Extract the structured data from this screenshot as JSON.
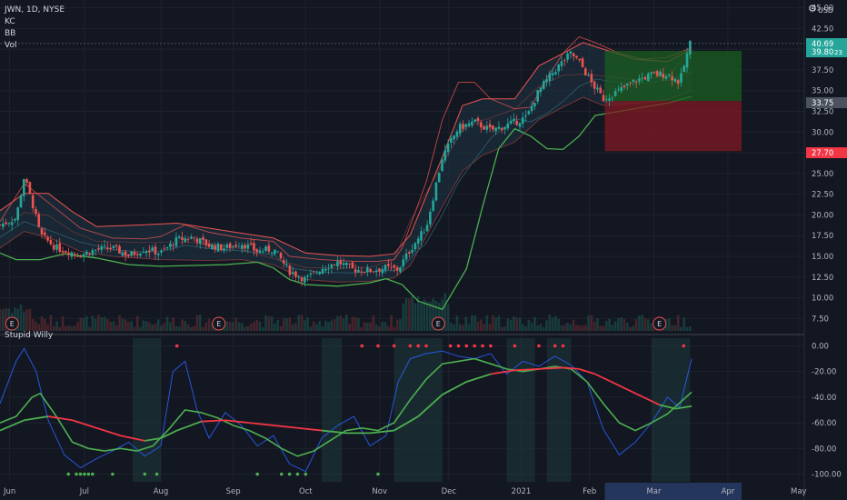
{
  "header": {
    "symbol": "JWN, 1D, NYSE",
    "indicators": [
      "KC",
      "BB",
      "Vol"
    ],
    "currency": "USD",
    "lower_pane_title": "Stupid Willy"
  },
  "colors": {
    "background": "#131722",
    "grid": "#1e222d",
    "up": "#26a69a",
    "down": "#ef5350",
    "kc": "#ef5350",
    "bb": "#4caf50",
    "kc_fill": "#1f3445",
    "profit": "#1b5e20",
    "loss": "#801922",
    "osc_blue": "#2962ff",
    "osc_green": "#4caf50",
    "osc_red": "#f23645"
  },
  "chart_data": {
    "type": "candlestick",
    "x_ticks": [
      "Jun",
      "Jul",
      "Aug",
      "Sep",
      "Oct",
      "Nov",
      "Dec",
      "2021",
      "Feb",
      "Mar",
      "Apr",
      "May"
    ],
    "y_ticks": [
      "45.00",
      "42.50",
      "40.00",
      "37.50",
      "35.00",
      "32.50",
      "30.00",
      "27.50",
      "25.00",
      "22.50",
      "20.00",
      "17.50",
      "15.00",
      "12.50",
      "10.00",
      "7.50"
    ],
    "ylim": [
      6.0,
      45.5
    ],
    "price_labels": [
      {
        "text": "40.69",
        "value": 40.69,
        "color": "#26a69a"
      },
      {
        "text": "39.80",
        "value": 39.8,
        "color": "#26a69a"
      },
      {
        "text": "33.75",
        "value": 33.75,
        "color": "#4c525e"
      },
      {
        "text": "27.70",
        "value": 27.7,
        "color": "#f23645"
      }
    ],
    "price_label_extra": "23",
    "earnings_markers": [
      {
        "label": "E",
        "x_pos": 0.015
      },
      {
        "label": "E",
        "x_pos": 0.272
      },
      {
        "label": "E",
        "x_pos": 0.545
      },
      {
        "label": "E",
        "x_pos": 0.82
      }
    ],
    "position_box": {
      "entry": 33.75,
      "target": 39.8,
      "stop": 27.7,
      "start": 0.752,
      "end": 0.922
    },
    "price_series": {
      "close": [
        [
          0.0,
          18.8
        ],
        [
          0.02,
          19.6
        ],
        [
          0.03,
          24.6
        ],
        [
          0.04,
          21.5
        ],
        [
          0.05,
          17.6
        ],
        [
          0.07,
          16.0
        ],
        [
          0.1,
          15.2
        ],
        [
          0.12,
          15.8
        ],
        [
          0.14,
          16.0
        ],
        [
          0.16,
          15.1
        ],
        [
          0.18,
          15.9
        ],
        [
          0.2,
          15.4
        ],
        [
          0.22,
          17.0
        ],
        [
          0.24,
          17.3
        ],
        [
          0.26,
          16.3
        ],
        [
          0.28,
          16.0
        ],
        [
          0.3,
          16.6
        ],
        [
          0.32,
          15.6
        ],
        [
          0.34,
          15.9
        ],
        [
          0.36,
          13.2
        ],
        [
          0.38,
          12.2
        ],
        [
          0.4,
          13.6
        ],
        [
          0.42,
          14.3
        ],
        [
          0.44,
          13.4
        ],
        [
          0.46,
          13.3
        ],
        [
          0.48,
          13.6
        ],
        [
          0.495,
          13.4
        ],
        [
          0.51,
          15.8
        ],
        [
          0.53,
          18.5
        ],
        [
          0.55,
          27.0
        ],
        [
          0.57,
          30.5
        ],
        [
          0.59,
          31.2
        ],
        [
          0.61,
          30.2
        ],
        [
          0.63,
          30.8
        ],
        [
          0.655,
          31.8
        ],
        [
          0.67,
          35.0
        ],
        [
          0.69,
          37.5
        ],
        [
          0.71,
          39.5
        ],
        [
          0.722,
          38.2
        ],
        [
          0.735,
          36.0
        ],
        [
          0.75,
          34.0
        ],
        [
          0.77,
          35.0
        ],
        [
          0.79,
          36.2
        ],
        [
          0.81,
          36.9
        ],
        [
          0.83,
          37.0
        ],
        [
          0.845,
          36.0
        ],
        [
          0.858,
          40.7
        ]
      ],
      "keltner_upper": [
        [
          0.0,
          20.5
        ],
        [
          0.03,
          22.6
        ],
        [
          0.06,
          22.6
        ],
        [
          0.09,
          20.4
        ],
        [
          0.12,
          18.6
        ],
        [
          0.18,
          18.8
        ],
        [
          0.22,
          19.0
        ],
        [
          0.26,
          18.4
        ],
        [
          0.3,
          17.8
        ],
        [
          0.34,
          17.2
        ],
        [
          0.38,
          15.4
        ],
        [
          0.42,
          15.1
        ],
        [
          0.46,
          15.0
        ],
        [
          0.49,
          15.3
        ],
        [
          0.51,
          17.6
        ],
        [
          0.55,
          27.0
        ],
        [
          0.575,
          33.2
        ],
        [
          0.6,
          34.0
        ],
        [
          0.64,
          34.0
        ],
        [
          0.67,
          38.0
        ],
        [
          0.7,
          39.5
        ],
        [
          0.725,
          40.8
        ],
        [
          0.75,
          40.0
        ],
        [
          0.79,
          38.8
        ],
        [
          0.83,
          38.5
        ],
        [
          0.86,
          40.0
        ]
      ],
      "keltner_lower": [
        [
          0.0,
          16.0
        ],
        [
          0.03,
          18.0
        ],
        [
          0.06,
          17.3
        ],
        [
          0.1,
          15.6
        ],
        [
          0.14,
          15.0
        ],
        [
          0.2,
          14.6
        ],
        [
          0.26,
          14.5
        ],
        [
          0.3,
          14.6
        ],
        [
          0.34,
          14.0
        ],
        [
          0.38,
          12.2
        ],
        [
          0.42,
          11.9
        ],
        [
          0.46,
          12.0
        ],
        [
          0.49,
          12.4
        ],
        [
          0.51,
          13.9
        ],
        [
          0.55,
          21.0
        ],
        [
          0.575,
          25.3
        ],
        [
          0.6,
          27.2
        ],
        [
          0.64,
          28.8
        ],
        [
          0.67,
          31.5
        ],
        [
          0.7,
          33.0
        ],
        [
          0.725,
          34.2
        ],
        [
          0.75,
          33.2
        ],
        [
          0.79,
          33.5
        ],
        [
          0.83,
          33.9
        ],
        [
          0.86,
          35.0
        ]
      ],
      "bollinger_upper": [
        [
          0.0,
          19.2
        ],
        [
          0.03,
          23.8
        ],
        [
          0.06,
          21.5
        ],
        [
          0.1,
          18.4
        ],
        [
          0.14,
          17.2
        ],
        [
          0.18,
          17.1
        ],
        [
          0.2,
          17.4
        ],
        [
          0.23,
          18.8
        ],
        [
          0.26,
          17.9
        ],
        [
          0.3,
          17.2
        ],
        [
          0.34,
          16.8
        ],
        [
          0.36,
          15.0
        ],
        [
          0.4,
          14.6
        ],
        [
          0.44,
          14.4
        ],
        [
          0.47,
          14.4
        ],
        [
          0.49,
          14.6
        ],
        [
          0.5,
          16.0
        ],
        [
          0.53,
          24.0
        ],
        [
          0.55,
          31.5
        ],
        [
          0.57,
          36.0
        ],
        [
          0.59,
          36.0
        ],
        [
          0.61,
          34.0
        ],
        [
          0.64,
          32.8
        ],
        [
          0.66,
          33.0
        ],
        [
          0.68,
          36.5
        ],
        [
          0.7,
          39.5
        ],
        [
          0.72,
          41.5
        ],
        [
          0.74,
          40.8
        ],
        [
          0.77,
          39.5
        ],
        [
          0.8,
          38.8
        ],
        [
          0.83,
          39.0
        ],
        [
          0.86,
          40.2
        ]
      ],
      "bollinger_lower": [
        [
          0.0,
          15.4
        ],
        [
          0.02,
          14.6
        ],
        [
          0.05,
          14.6
        ],
        [
          0.08,
          15.3
        ],
        [
          0.12,
          14.8
        ],
        [
          0.16,
          14.0
        ],
        [
          0.2,
          13.8
        ],
        [
          0.24,
          13.9
        ],
        [
          0.28,
          14.0
        ],
        [
          0.32,
          14.3
        ],
        [
          0.34,
          13.6
        ],
        [
          0.36,
          12.2
        ],
        [
          0.38,
          11.6
        ],
        [
          0.42,
          11.4
        ],
        [
          0.46,
          11.8
        ],
        [
          0.48,
          12.3
        ],
        [
          0.5,
          11.6
        ],
        [
          0.52,
          9.6
        ],
        [
          0.55,
          8.6
        ],
        [
          0.58,
          13.5
        ],
        [
          0.6,
          21.0
        ],
        [
          0.62,
          28.0
        ],
        [
          0.64,
          30.4
        ],
        [
          0.66,
          29.5
        ],
        [
          0.68,
          28.0
        ],
        [
          0.7,
          27.9
        ],
        [
          0.72,
          29.5
        ],
        [
          0.74,
          32.0
        ],
        [
          0.77,
          32.5
        ],
        [
          0.8,
          33.0
        ],
        [
          0.83,
          33.5
        ],
        [
          0.86,
          34.3
        ]
      ]
    },
    "oscillator": {
      "ylim": [
        -106,
        6
      ],
      "y_ticks": [
        "0.00",
        "-20.00",
        "-40.00",
        "-60.00",
        "-80.00",
        "-100.00"
      ],
      "fast_line": [
        [
          0.0,
          -45
        ],
        [
          0.02,
          -12
        ],
        [
          0.03,
          -2
        ],
        [
          0.045,
          -20
        ],
        [
          0.06,
          -58
        ],
        [
          0.08,
          -85
        ],
        [
          0.1,
          -95
        ],
        [
          0.12,
          -88
        ],
        [
          0.14,
          -82
        ],
        [
          0.16,
          -75
        ],
        [
          0.18,
          -86
        ],
        [
          0.2,
          -78
        ],
        [
          0.215,
          -20
        ],
        [
          0.23,
          -12
        ],
        [
          0.245,
          -50
        ],
        [
          0.26,
          -72
        ],
        [
          0.28,
          -52
        ],
        [
          0.3,
          -62
        ],
        [
          0.32,
          -78
        ],
        [
          0.34,
          -70
        ],
        [
          0.36,
          -92
        ],
        [
          0.38,
          -98
        ],
        [
          0.4,
          -72
        ],
        [
          0.42,
          -62
        ],
        [
          0.44,
          -55
        ],
        [
          0.46,
          -78
        ],
        [
          0.48,
          -70
        ],
        [
          0.495,
          -28
        ],
        [
          0.51,
          -10
        ],
        [
          0.53,
          -6
        ],
        [
          0.55,
          -4
        ],
        [
          0.57,
          -8
        ],
        [
          0.59,
          -10
        ],
        [
          0.61,
          -6
        ],
        [
          0.63,
          -22
        ],
        [
          0.65,
          -12
        ],
        [
          0.67,
          -16
        ],
        [
          0.69,
          -8
        ],
        [
          0.71,
          -15
        ],
        [
          0.73,
          -28
        ],
        [
          0.75,
          -65
        ],
        [
          0.77,
          -85
        ],
        [
          0.79,
          -75
        ],
        [
          0.81,
          -60
        ],
        [
          0.83,
          -40
        ],
        [
          0.845,
          -48
        ],
        [
          0.86,
          -10
        ]
      ],
      "slow_line": [
        [
          0.0,
          -60
        ],
        [
          0.02,
          -55
        ],
        [
          0.04,
          -40
        ],
        [
          0.05,
          -37
        ],
        [
          0.07,
          -55
        ],
        [
          0.09,
          -75
        ],
        [
          0.11,
          -80
        ],
        [
          0.13,
          -82
        ],
        [
          0.15,
          -80
        ],
        [
          0.17,
          -82
        ],
        [
          0.19,
          -78
        ],
        [
          0.21,
          -65
        ],
        [
          0.23,
          -50
        ],
        [
          0.25,
          -52
        ],
        [
          0.27,
          -56
        ],
        [
          0.29,
          -62
        ],
        [
          0.31,
          -66
        ],
        [
          0.33,
          -72
        ],
        [
          0.35,
          -80
        ],
        [
          0.37,
          -86
        ],
        [
          0.39,
          -82
        ],
        [
          0.41,
          -74
        ],
        [
          0.43,
          -66
        ],
        [
          0.45,
          -64
        ],
        [
          0.47,
          -66
        ],
        [
          0.49,
          -60
        ],
        [
          0.51,
          -42
        ],
        [
          0.53,
          -26
        ],
        [
          0.55,
          -14
        ],
        [
          0.57,
          -12
        ],
        [
          0.59,
          -10
        ],
        [
          0.61,
          -14
        ],
        [
          0.63,
          -18
        ],
        [
          0.65,
          -20
        ],
        [
          0.67,
          -18
        ],
        [
          0.69,
          -16
        ],
        [
          0.71,
          -18
        ],
        [
          0.73,
          -28
        ],
        [
          0.75,
          -45
        ],
        [
          0.77,
          -60
        ],
        [
          0.79,
          -66
        ],
        [
          0.81,
          -60
        ],
        [
          0.83,
          -53
        ],
        [
          0.86,
          -36
        ]
      ],
      "signal_line": [
        [
          0.0,
          -66
        ],
        [
          0.03,
          -58
        ],
        [
          0.06,
          -55
        ],
        [
          0.09,
          -58
        ],
        [
          0.12,
          -64
        ],
        [
          0.15,
          -70
        ],
        [
          0.18,
          -74
        ],
        [
          0.2,
          -72
        ],
        [
          0.22,
          -66
        ],
        [
          0.25,
          -59
        ],
        [
          0.28,
          -58
        ],
        [
          0.31,
          -60
        ],
        [
          0.34,
          -62
        ],
        [
          0.37,
          -64
        ],
        [
          0.4,
          -66
        ],
        [
          0.43,
          -68
        ],
        [
          0.46,
          -68
        ],
        [
          0.49,
          -66
        ],
        [
          0.52,
          -55
        ],
        [
          0.55,
          -38
        ],
        [
          0.58,
          -28
        ],
        [
          0.61,
          -22
        ],
        [
          0.64,
          -19
        ],
        [
          0.67,
          -18
        ],
        [
          0.7,
          -17
        ],
        [
          0.72,
          -18
        ],
        [
          0.74,
          -22
        ],
        [
          0.76,
          -28
        ],
        [
          0.78,
          -34
        ],
        [
          0.8,
          -40
        ],
        [
          0.82,
          -46
        ],
        [
          0.84,
          -49
        ],
        [
          0.86,
          -47
        ]
      ]
    }
  }
}
